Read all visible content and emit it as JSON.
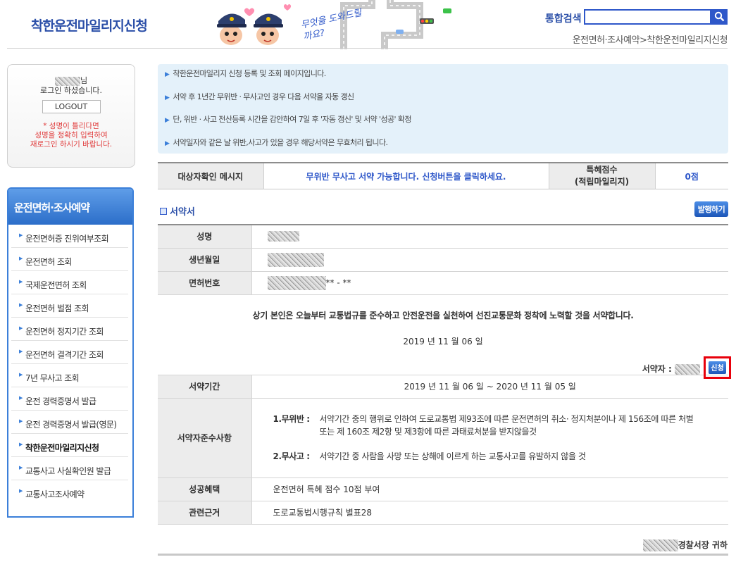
{
  "header": {
    "page_title": "착한운전마일리지신청",
    "banner_text": "무엇을 도와드릴까요?",
    "search_label": "통합검색",
    "breadcrumb": "운전면허·조사예약>착한운전마일리지신청"
  },
  "login": {
    "name_suffix": "님",
    "logged_in_text": "로그인 하셨습니다.",
    "logout_label": "LOGOUT",
    "warning_line1": "* 성명이 틀리다면",
    "warning_line2": "성명을 정확히 입력하여",
    "warning_line3": "재로그인 하시기 바랍니다."
  },
  "sidebar": {
    "title": "운전면허·조사예약",
    "items": [
      {
        "label": "운전면허증 진위여부조회"
      },
      {
        "label": "운전면허 조회"
      },
      {
        "label": "국제운전면허 조회"
      },
      {
        "label": "운전면허 벌점 조회"
      },
      {
        "label": "운전면허 정지기간 조회"
      },
      {
        "label": "운전면허 결격기간 조회"
      },
      {
        "label": "7년 무사고 조회"
      },
      {
        "label": "운전 경력증명서 발급"
      },
      {
        "label": "운전 경력증명서 발급(영문)"
      },
      {
        "label": "착한운전마일리지신청"
      },
      {
        "label": "교통사고 사실확인원 발급"
      },
      {
        "label": "교통사고조사예약"
      }
    ]
  },
  "notice": [
    "착한운전마일리지 신청 등록 및 조회 페이지입니다.",
    "서약 후 1년간 무위반 · 무사고인 경우 다음 서약을 자동 갱신",
    "단, 위반 · 사고 전산등록 시간을 감안하여 7일 후 '자동 갱신' 및 서약 '성공' 확정",
    "서약일자와 같은 날 위반,사고가 있을 경우 해당서약은 무효처리 됩니다."
  ],
  "status": {
    "label": "대상자확인 메시지",
    "message": "무위반 무사고 서약 가능합니다. 신청버튼을 클릭하세요.",
    "score_label_line1": "특혜점수",
    "score_label_line2": "(적립마일리지)",
    "score_value": "0점"
  },
  "pledge": {
    "section_title": "서약서",
    "issue_button": "발행하기",
    "name_label": "성명",
    "birth_label": "생년월일",
    "license_label": "면허번호",
    "license_suffix": "** - **",
    "statement": "상기 본인은 오늘부터 교통법규를 준수하고 안전운전을 실천하여 선진교통문화 정착에 노력할 것을 서약합니다.",
    "date": "2019 년 11 월 06 일",
    "signer_label": "서약자 :",
    "apply_button": "신청",
    "period_label": "서약기간",
    "period_value": "2019 년 11 월 06 일 ~ 2020 년 11 월 05 일",
    "rules_label": "서약자준수사항",
    "rules": [
      {
        "key": "1.무위반 :",
        "text": "서약기간 중의 행위로 인하여 도로교통법 제93조에 따른 운전면허의 취소· 정지처분이나 제 156조에 따른 처벌 또는 제 160조 제2항 및 제3항에 따른 과태료처분을 받지않을것"
      },
      {
        "key": "2.무사고 :",
        "text": "서약기간 중 사람을 사망 또는 상해에 이르게 하는 교통사고를 유발하지 않을 것"
      }
    ],
    "benefit_label": "성공혜택",
    "benefit_value": "운전면허 특혜 점수 10점 부여",
    "basis_label": "관련근거",
    "basis_value": "도로교통법시행규칙 별표28"
  },
  "footer": {
    "sign": "경찰서장 귀하"
  },
  "colors": {
    "brand_blue": "#2b4fa8",
    "accent_blue": "#2e57c9",
    "highlight_red": "#e8000b",
    "notice_bg": "#e4f1fa"
  }
}
